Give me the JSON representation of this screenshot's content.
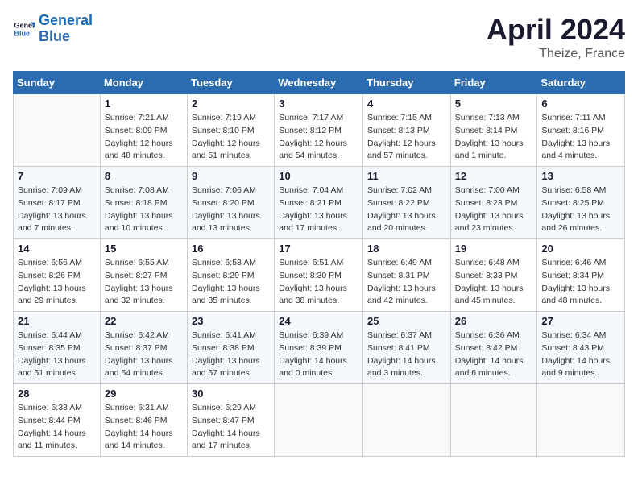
{
  "header": {
    "logo_line1": "General",
    "logo_line2": "Blue",
    "month": "April 2024",
    "location": "Theize, France"
  },
  "columns": [
    "Sunday",
    "Monday",
    "Tuesday",
    "Wednesday",
    "Thursday",
    "Friday",
    "Saturday"
  ],
  "weeks": [
    [
      {
        "day": "",
        "info": ""
      },
      {
        "day": "1",
        "info": "Sunrise: 7:21 AM\nSunset: 8:09 PM\nDaylight: 12 hours\nand 48 minutes."
      },
      {
        "day": "2",
        "info": "Sunrise: 7:19 AM\nSunset: 8:10 PM\nDaylight: 12 hours\nand 51 minutes."
      },
      {
        "day": "3",
        "info": "Sunrise: 7:17 AM\nSunset: 8:12 PM\nDaylight: 12 hours\nand 54 minutes."
      },
      {
        "day": "4",
        "info": "Sunrise: 7:15 AM\nSunset: 8:13 PM\nDaylight: 12 hours\nand 57 minutes."
      },
      {
        "day": "5",
        "info": "Sunrise: 7:13 AM\nSunset: 8:14 PM\nDaylight: 13 hours\nand 1 minute."
      },
      {
        "day": "6",
        "info": "Sunrise: 7:11 AM\nSunset: 8:16 PM\nDaylight: 13 hours\nand 4 minutes."
      }
    ],
    [
      {
        "day": "7",
        "info": "Sunrise: 7:09 AM\nSunset: 8:17 PM\nDaylight: 13 hours\nand 7 minutes."
      },
      {
        "day": "8",
        "info": "Sunrise: 7:08 AM\nSunset: 8:18 PM\nDaylight: 13 hours\nand 10 minutes."
      },
      {
        "day": "9",
        "info": "Sunrise: 7:06 AM\nSunset: 8:20 PM\nDaylight: 13 hours\nand 13 minutes."
      },
      {
        "day": "10",
        "info": "Sunrise: 7:04 AM\nSunset: 8:21 PM\nDaylight: 13 hours\nand 17 minutes."
      },
      {
        "day": "11",
        "info": "Sunrise: 7:02 AM\nSunset: 8:22 PM\nDaylight: 13 hours\nand 20 minutes."
      },
      {
        "day": "12",
        "info": "Sunrise: 7:00 AM\nSunset: 8:23 PM\nDaylight: 13 hours\nand 23 minutes."
      },
      {
        "day": "13",
        "info": "Sunrise: 6:58 AM\nSunset: 8:25 PM\nDaylight: 13 hours\nand 26 minutes."
      }
    ],
    [
      {
        "day": "14",
        "info": "Sunrise: 6:56 AM\nSunset: 8:26 PM\nDaylight: 13 hours\nand 29 minutes."
      },
      {
        "day": "15",
        "info": "Sunrise: 6:55 AM\nSunset: 8:27 PM\nDaylight: 13 hours\nand 32 minutes."
      },
      {
        "day": "16",
        "info": "Sunrise: 6:53 AM\nSunset: 8:29 PM\nDaylight: 13 hours\nand 35 minutes."
      },
      {
        "day": "17",
        "info": "Sunrise: 6:51 AM\nSunset: 8:30 PM\nDaylight: 13 hours\nand 38 minutes."
      },
      {
        "day": "18",
        "info": "Sunrise: 6:49 AM\nSunset: 8:31 PM\nDaylight: 13 hours\nand 42 minutes."
      },
      {
        "day": "19",
        "info": "Sunrise: 6:48 AM\nSunset: 8:33 PM\nDaylight: 13 hours\nand 45 minutes."
      },
      {
        "day": "20",
        "info": "Sunrise: 6:46 AM\nSunset: 8:34 PM\nDaylight: 13 hours\nand 48 minutes."
      }
    ],
    [
      {
        "day": "21",
        "info": "Sunrise: 6:44 AM\nSunset: 8:35 PM\nDaylight: 13 hours\nand 51 minutes."
      },
      {
        "day": "22",
        "info": "Sunrise: 6:42 AM\nSunset: 8:37 PM\nDaylight: 13 hours\nand 54 minutes."
      },
      {
        "day": "23",
        "info": "Sunrise: 6:41 AM\nSunset: 8:38 PM\nDaylight: 13 hours\nand 57 minutes."
      },
      {
        "day": "24",
        "info": "Sunrise: 6:39 AM\nSunset: 8:39 PM\nDaylight: 14 hours\nand 0 minutes."
      },
      {
        "day": "25",
        "info": "Sunrise: 6:37 AM\nSunset: 8:41 PM\nDaylight: 14 hours\nand 3 minutes."
      },
      {
        "day": "26",
        "info": "Sunrise: 6:36 AM\nSunset: 8:42 PM\nDaylight: 14 hours\nand 6 minutes."
      },
      {
        "day": "27",
        "info": "Sunrise: 6:34 AM\nSunset: 8:43 PM\nDaylight: 14 hours\nand 9 minutes."
      }
    ],
    [
      {
        "day": "28",
        "info": "Sunrise: 6:33 AM\nSunset: 8:44 PM\nDaylight: 14 hours\nand 11 minutes."
      },
      {
        "day": "29",
        "info": "Sunrise: 6:31 AM\nSunset: 8:46 PM\nDaylight: 14 hours\nand 14 minutes."
      },
      {
        "day": "30",
        "info": "Sunrise: 6:29 AM\nSunset: 8:47 PM\nDaylight: 14 hours\nand 17 minutes."
      },
      {
        "day": "",
        "info": ""
      },
      {
        "day": "",
        "info": ""
      },
      {
        "day": "",
        "info": ""
      },
      {
        "day": "",
        "info": ""
      }
    ]
  ]
}
